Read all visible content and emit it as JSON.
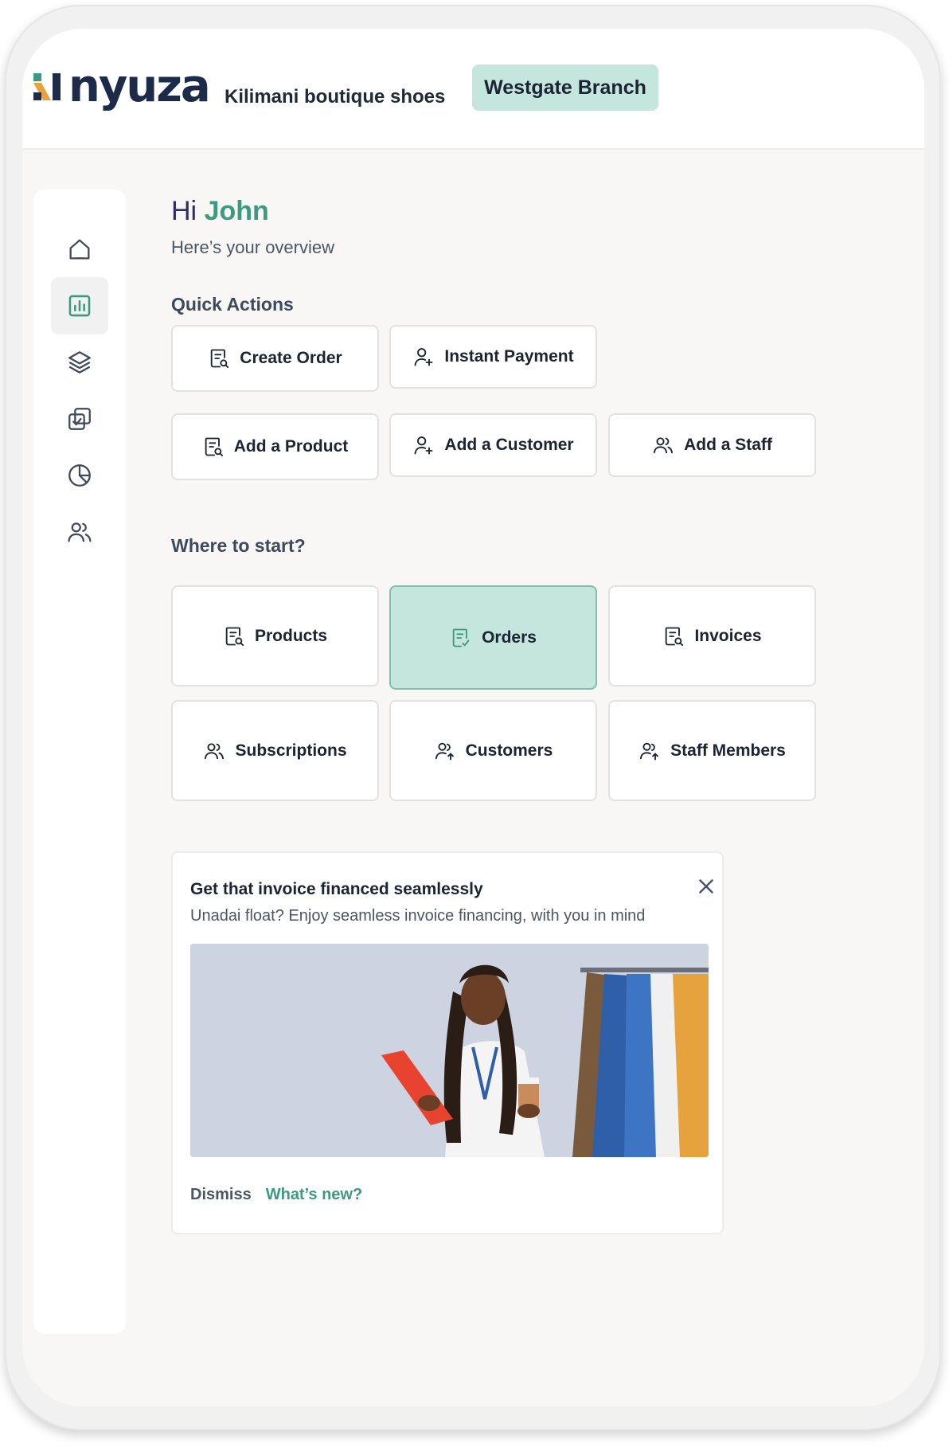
{
  "header": {
    "logo_text": "nyuza",
    "company_name": "Kilimani boutique shoes",
    "branch": "Westgate Branch",
    "brand_colors": {
      "green": "#3b9a7f",
      "navy": "#1d2b4a",
      "accent_bg": "#c5e6dd"
    }
  },
  "sidebar": {
    "items": [
      {
        "icon": "home-icon",
        "active": false
      },
      {
        "icon": "bar-chart-icon",
        "active": true
      },
      {
        "icon": "layers-icon",
        "active": false
      },
      {
        "icon": "copy-check-icon",
        "active": false
      },
      {
        "icon": "pie-chart-icon",
        "active": false
      },
      {
        "icon": "users-icon",
        "active": false
      }
    ]
  },
  "greeting": {
    "hi": "Hi",
    "name": "John",
    "subtitle": "Here’s your overview"
  },
  "quick_actions": {
    "title": "Quick Actions",
    "items": [
      {
        "label": "Create Order",
        "icon": "receipt-search-icon"
      },
      {
        "label": "Instant Payment",
        "icon": "user-plus-icon"
      },
      {
        "label": "Add a Product",
        "icon": "receipt-search-icon"
      },
      {
        "label": "Add a Customer",
        "icon": "user-plus-icon"
      },
      {
        "label": "Add a Staff",
        "icon": "users-icon"
      }
    ]
  },
  "where_to_start": {
    "title": "Where to start?",
    "items": [
      {
        "label": "Products",
        "icon": "receipt-search-icon",
        "selected": false
      },
      {
        "label": "Orders",
        "icon": "receipt-check-icon",
        "selected": true
      },
      {
        "label": "Invoices",
        "icon": "receipt-search-icon",
        "selected": false
      },
      {
        "label": "Subscriptions",
        "icon": "users-icon",
        "selected": false
      },
      {
        "label": "Customers",
        "icon": "user-arrow-icon",
        "selected": false
      },
      {
        "label": "Staff Members",
        "icon": "user-arrow-icon",
        "selected": false
      }
    ]
  },
  "promo": {
    "title": "Get that invoice financed seamlessly",
    "text": "Unadai float? Enjoy seamless invoice financing, with you in mind",
    "dismiss": "Dismiss",
    "whats_new": "What’s new?"
  }
}
